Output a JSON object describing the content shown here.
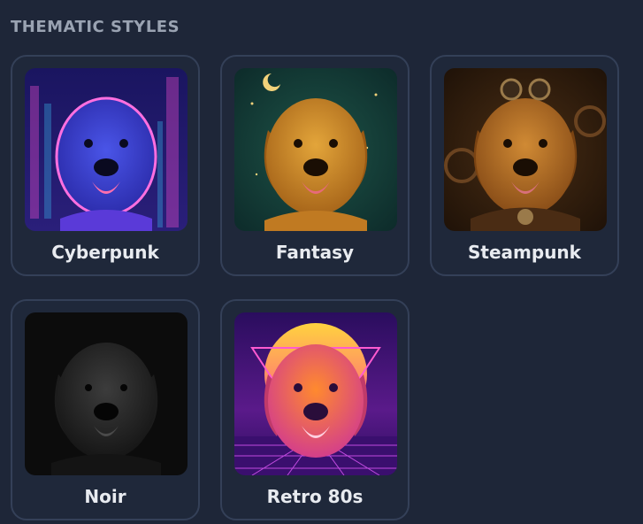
{
  "section": {
    "title": "THEMATIC STYLES"
  },
  "styles": [
    {
      "label": "Cyberpunk",
      "icon": "cyberpunk-dog-thumbnail",
      "palette": [
        "#1a1560",
        "#3b3bd8",
        "#ff4fd8"
      ]
    },
    {
      "label": "Fantasy",
      "icon": "fantasy-dog-thumbnail",
      "palette": [
        "#0f3a3a",
        "#c98a1e",
        "#f2c65a"
      ]
    },
    {
      "label": "Steampunk",
      "icon": "steampunk-dog-thumbnail",
      "palette": [
        "#2a1a0c",
        "#a8611f",
        "#d79a45"
      ]
    },
    {
      "label": "Noir",
      "icon": "noir-dog-thumbnail",
      "palette": [
        "#0c0c0c",
        "#2b2b2b",
        "#6a6a6a"
      ]
    },
    {
      "label": "Retro 80s",
      "icon": "retro-80s-dog-thumbnail",
      "palette": [
        "#2a0d5e",
        "#ff7a2e",
        "#ffd23f"
      ]
    }
  ]
}
